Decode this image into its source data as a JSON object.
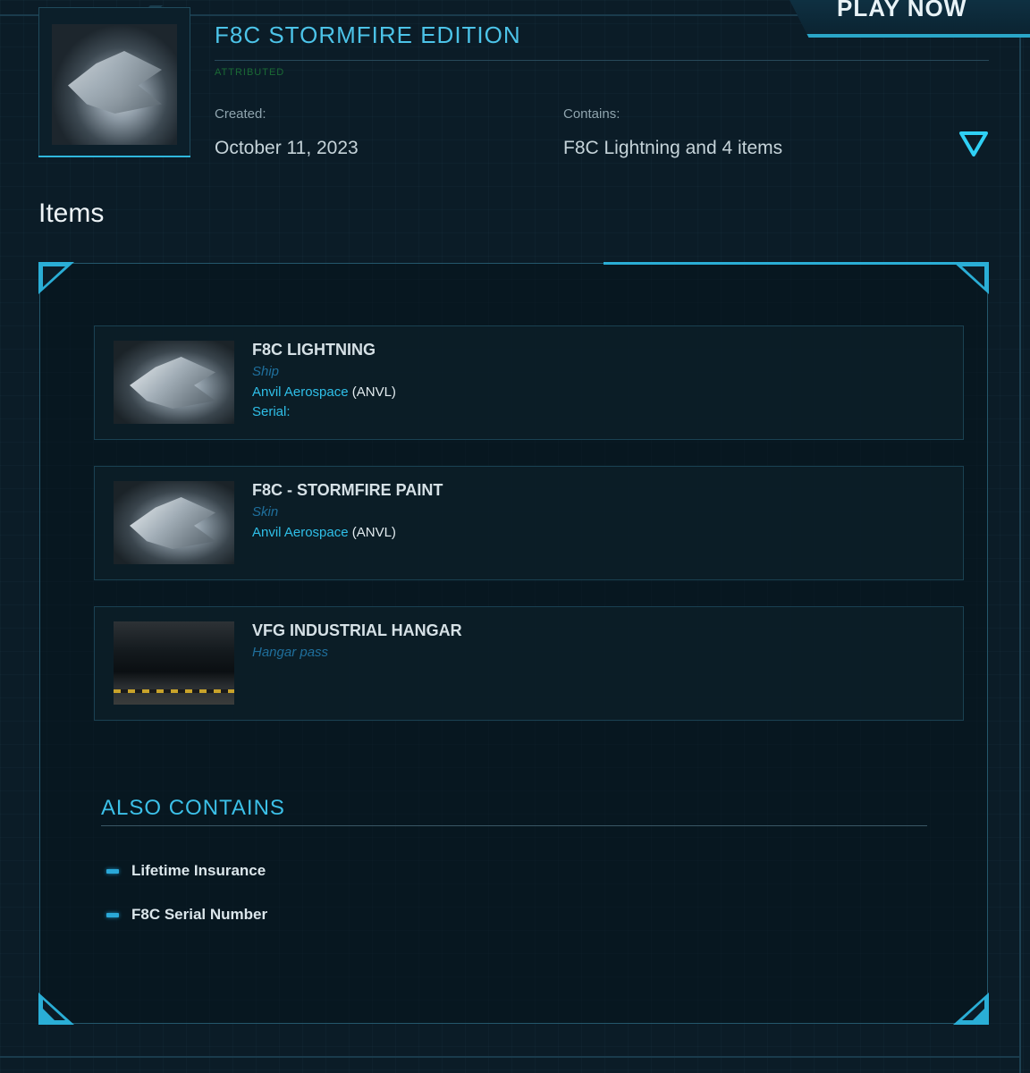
{
  "header": {
    "play_now_label": "PLAY NOW"
  },
  "pledge": {
    "title": "F8C STORMFIRE EDITION",
    "status": "ATTRIBUTED",
    "created_label": "Created:",
    "created_value": "October 11, 2023",
    "contains_label": "Contains:",
    "contains_value": "F8C Lightning and 4 items",
    "toggle_icon": "triangle-down-icon"
  },
  "items_section": {
    "heading": "Items",
    "items": [
      {
        "name": "F8C LIGHTNING",
        "kind": "Ship",
        "manufacturer": "Anvil Aerospace",
        "manufacturer_code": "(ANVL)",
        "serial_label": "Serial:",
        "thumbnail": "f8c-ship-image"
      },
      {
        "name": "F8C - STORMFIRE PAINT",
        "kind": "Skin",
        "manufacturer": "Anvil Aerospace",
        "manufacturer_code": "(ANVL)",
        "thumbnail": "f8c-ship-image"
      },
      {
        "name": "VFG INDUSTRIAL HANGAR",
        "kind": "Hangar pass",
        "thumbnail": "hangar-image"
      }
    ]
  },
  "also_contains": {
    "heading": "ALSO CONTAINS",
    "items": [
      "Lifetime Insurance",
      "F8C Serial Number"
    ]
  },
  "colors": {
    "background": "#0b1c27",
    "accent": "#2fbfe8",
    "title": "#4cc3e8",
    "status_green": "#1b6b35"
  }
}
